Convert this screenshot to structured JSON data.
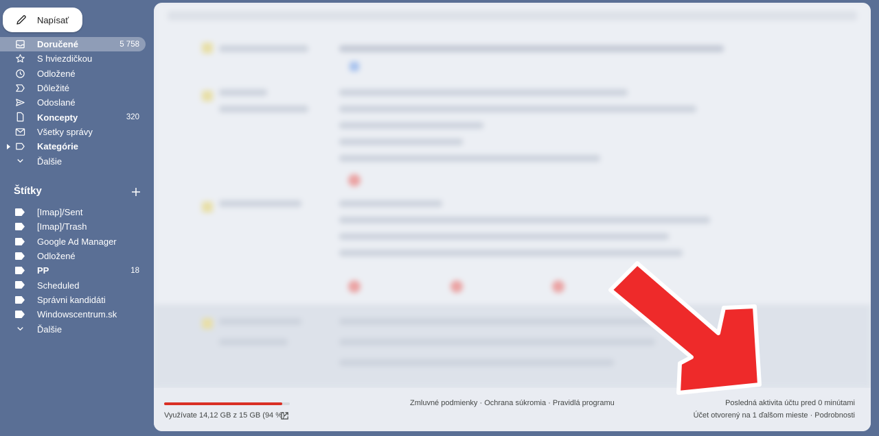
{
  "compose": {
    "label": "Napísať",
    "icon": "pencil-icon"
  },
  "nav": [
    {
      "label": "Doručené",
      "count": "5 758",
      "icon": "inbox-icon",
      "bold": true,
      "active": true
    },
    {
      "label": "S hviezdičkou",
      "count": "",
      "icon": "star-icon"
    },
    {
      "label": "Odložené",
      "count": "",
      "icon": "clock-icon"
    },
    {
      "label": "Dôležité",
      "count": "",
      "icon": "important-icon"
    },
    {
      "label": "Odoslané",
      "count": "",
      "icon": "send-icon"
    },
    {
      "label": "Koncepty",
      "count": "320",
      "icon": "draft-icon",
      "bold": true
    },
    {
      "label": "Všetky správy",
      "count": "",
      "icon": "all-mail-icon"
    },
    {
      "label": "Kategórie",
      "count": "",
      "icon": "category-icon",
      "bold": true,
      "expandable": true
    },
    {
      "label": "Ďalšie",
      "count": "",
      "icon": "chevron-down-icon"
    }
  ],
  "labels_section": {
    "title": "Štítky",
    "add_icon": "plus-icon",
    "items": [
      {
        "label": "[Imap]/Sent",
        "count": ""
      },
      {
        "label": "[Imap]/Trash",
        "count": ""
      },
      {
        "label": "Google Ad Manager",
        "count": ""
      },
      {
        "label": "Odložené",
        "count": ""
      },
      {
        "label": "PP",
        "count": "18",
        "bold": true
      },
      {
        "label": "Scheduled",
        "count": ""
      },
      {
        "label": "Správni kandidáti",
        "count": ""
      },
      {
        "label": "Windowscentrum.sk",
        "count": ""
      }
    ],
    "more": "Ďalšie"
  },
  "footer": {
    "storage_text": "Využívate 14,12 GB z 15 GB (94 %)",
    "storage_fraction": 0.94,
    "storage_color": "#d93025",
    "terms": "Zmluvné podmienky · Ochrana súkromia · Pravidlá programu",
    "last_activity": "Posledná aktivita účtu pred 0 minútami",
    "open_sessions": "Účet otvorený na 1 ďalšom mieste · Podrobnosti"
  },
  "annotation": {
    "type": "red-arrow",
    "color": "#ee2a2a",
    "points_to": "footer-activity"
  }
}
